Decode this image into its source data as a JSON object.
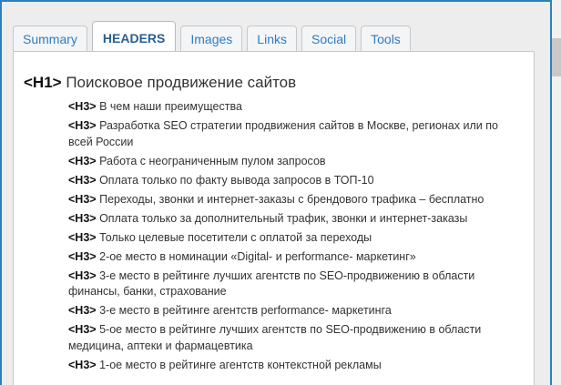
{
  "tabs": [
    {
      "label": "Summary",
      "active": false
    },
    {
      "label": "HEADERS",
      "active": true
    },
    {
      "label": "Images",
      "active": false
    },
    {
      "label": "Links",
      "active": false
    },
    {
      "label": "Social",
      "active": false
    },
    {
      "label": "Tools",
      "active": false
    }
  ],
  "headers": {
    "h1": {
      "tag": "<H1>",
      "text": "Поисковое продвижение сайтов"
    },
    "h3": [
      {
        "tag": "<H3>",
        "text": "В чем наши преимущества"
      },
      {
        "tag": "<H3>",
        "text": "Разработка SEO стратегии продвижения сайтов в Москве, регионах или по всей России"
      },
      {
        "tag": "<H3>",
        "text": "Работа с неограниченным пулом запросов"
      },
      {
        "tag": "<H3>",
        "text": "Оплата только по факту вывода запросов в ТОП-10"
      },
      {
        "tag": "<H3>",
        "text": "Переходы, звонки и интернет-заказы с брендового трафика – бесплатно"
      },
      {
        "tag": "<H3>",
        "text": "Оплата только за дополнительный трафик, звонки и интернет-заказы"
      },
      {
        "tag": "<H3>",
        "text": "Только целевые посетители с оплатой за переходы"
      },
      {
        "tag": "<H3>",
        "text": "2-ое место в номинации «Digital- и performance- маркетинг»"
      },
      {
        "tag": "<H3>",
        "text": "3-е место в рейтинге лучших агентств по SEO-продвижению в области финансы, банки, страхование"
      },
      {
        "tag": "<H3>",
        "text": "3-е место в рейтинге агентств performance- маркетинга"
      },
      {
        "tag": "<H3>",
        "text": "5-ое место в рейтинге лучших агентств по SEO-продвижению в области медицина, аптеки и фармацевтика"
      },
      {
        "tag": "<H3>",
        "text": "1-ое место в рейтинге агентств контекстной рекламы"
      }
    ]
  },
  "colors": {
    "frame": "#2b7fbf",
    "tab_text": "#2f7cc3",
    "active_tab_text": "#2a5f93"
  }
}
